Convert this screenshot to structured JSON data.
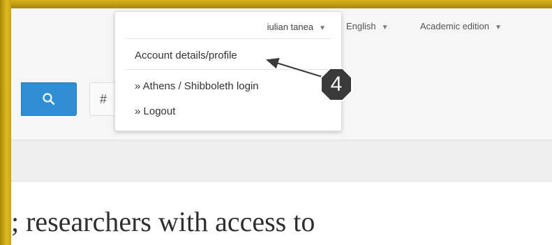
{
  "header": {
    "language_label": "English",
    "edition_label": "Academic edition"
  },
  "account_menu": {
    "username": "iulian tanea",
    "items": [
      {
        "label": "Account details/profile"
      },
      {
        "label": "» Athens / Shibboleth login"
      },
      {
        "label": "» Logout"
      }
    ]
  },
  "content": {
    "headline_fragment": "; researchers with access to"
  },
  "annotation": {
    "step_number": "4"
  },
  "colors": {
    "search_button": "#2f8ed4",
    "callout_badge": "#3a3a3a",
    "frame": "#d8b21a"
  },
  "icons": {
    "search": "search-icon",
    "caret": "caret-down-icon"
  }
}
